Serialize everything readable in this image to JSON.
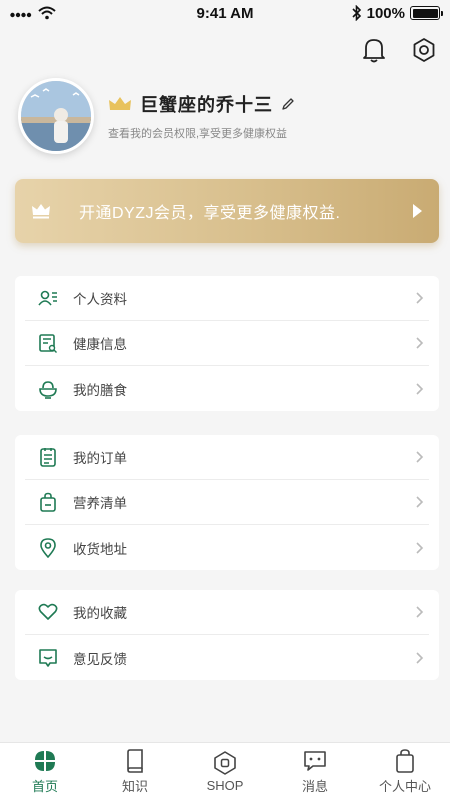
{
  "status_bar": {
    "time": "9:41 AM",
    "battery": "100%"
  },
  "profile": {
    "name": "巨蟹座的乔十三",
    "subtitle": "查看我的会员权限,享受更多健康权益"
  },
  "vip_banner": {
    "text": "开通DYZJ会员，享受更多健康权益."
  },
  "groups": [
    {
      "items": [
        {
          "label": "个人资料",
          "icon": "profile-card-icon"
        },
        {
          "label": "健康信息",
          "icon": "health-report-icon"
        },
        {
          "label": "我的膳食",
          "icon": "meal-bowl-icon"
        }
      ]
    },
    {
      "items": [
        {
          "label": "我的订单",
          "icon": "order-list-icon"
        },
        {
          "label": "营养清单",
          "icon": "shopping-bag-icon"
        },
        {
          "label": "收货地址",
          "icon": "location-pin-icon"
        }
      ]
    },
    {
      "items": [
        {
          "label": "我的收藏",
          "icon": "heart-icon"
        },
        {
          "label": "意见反馈",
          "icon": "feedback-icon"
        }
      ]
    }
  ],
  "tabs": [
    {
      "label": "首页",
      "icon": "home-grid-icon",
      "active": true
    },
    {
      "label": "知识",
      "icon": "book-icon",
      "active": false
    },
    {
      "label": "SHOP",
      "icon": "shop-icon",
      "active": false
    },
    {
      "label": "消息",
      "icon": "message-icon",
      "active": false
    },
    {
      "label": "个人中心",
      "icon": "user-center-icon",
      "active": false
    }
  ],
  "colors": {
    "accent": "#1f7a54",
    "gold": "#d8bf8d"
  }
}
